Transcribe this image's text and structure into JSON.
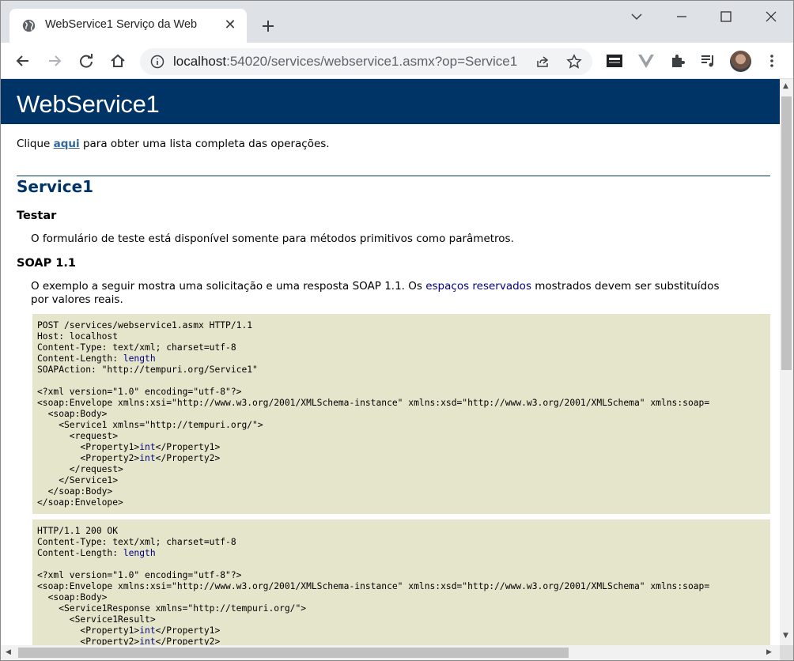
{
  "browser": {
    "tab_title": "WebService1 Serviço da Web",
    "url_host": "localhost",
    "url_path": ":54020/services/webservice1.asmx?op=Service1"
  },
  "page": {
    "banner_title": "WebService1",
    "intro_before": "Clique ",
    "intro_link": "aqui",
    "intro_after": " para obter uma lista completa das operações.",
    "operation_title": "Service1",
    "test_heading": "Testar",
    "test_text": "O formulário de teste está disponível somente para métodos primitivos como parâmetros.",
    "soap_heading": "SOAP 1.1",
    "soap_text_before": "O exemplo a seguir mostra uma solicitação e uma resposta SOAP 1.1. Os ",
    "soap_text_placeholder": "espaços reservados",
    "soap_text_after": " mostrados devem ser substituídos",
    "soap_text_line2": "por valores reais."
  },
  "request_code": {
    "l1": "POST /services/webservice1.asmx HTTP/1.1",
    "l2": "Host: localhost",
    "l3": "Content-Type: text/xml; charset=utf-8",
    "l4a": "Content-Length: ",
    "l4b": "length",
    "l5": "SOAPAction: \"http://tempuri.org/Service1\"",
    "l7": "<?xml version=\"1.0\" encoding=\"utf-8\"?>",
    "l8": "<soap:Envelope xmlns:xsi=\"http://www.w3.org/2001/XMLSchema-instance\" xmlns:xsd=\"http://www.w3.org/2001/XMLSchema\" xmlns:soap=",
    "l9": "  <soap:Body>",
    "l10": "    <Service1 xmlns=\"http://tempuri.org/\">",
    "l11": "      <request>",
    "l12a": "        <Property1>",
    "l12b": "int",
    "l12c": "</Property1>",
    "l13a": "        <Property2>",
    "l13b": "int",
    "l13c": "</Property2>",
    "l14": "      </request>",
    "l15": "    </Service1>",
    "l16": "  </soap:Body>",
    "l17": "</soap:Envelope>"
  },
  "response_code": {
    "l1": "HTTP/1.1 200 OK",
    "l2": "Content-Type: text/xml; charset=utf-8",
    "l3a": "Content-Length: ",
    "l3b": "length",
    "l5": "<?xml version=\"1.0\" encoding=\"utf-8\"?>",
    "l6": "<soap:Envelope xmlns:xsi=\"http://www.w3.org/2001/XMLSchema-instance\" xmlns:xsd=\"http://www.w3.org/2001/XMLSchema\" xmlns:soap=",
    "l7": "  <soap:Body>",
    "l8": "    <Service1Response xmlns=\"http://tempuri.org/\">",
    "l9": "      <Service1Result>",
    "l10a": "        <Property1>",
    "l10b": "int",
    "l10c": "</Property1>",
    "l11a": "        <Property2>",
    "l11b": "int",
    "l11c": "</Property2>"
  },
  "colors": {
    "banner": "#003366",
    "code_bg": "#e5e5cc",
    "placeholder": "#000080",
    "link": "#336699"
  }
}
